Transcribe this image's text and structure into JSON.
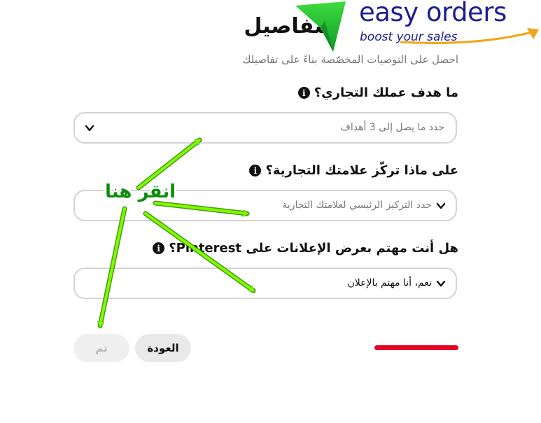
{
  "header": {
    "title": "التفاصيل",
    "subtitle": "احصل على التوصيات المخصّصة بناءً على تفاصيلك"
  },
  "logo": {
    "brand": "easy orders",
    "tagline": "boost your sales",
    "colors": {
      "text": "#1d1f8e",
      "triangle_top": "#3ddc3d",
      "triangle_bottom": "#0f9a2b",
      "swoosh": "#f2a516"
    }
  },
  "form": {
    "q1": {
      "label": "ما هدف عملك التجاري؟",
      "placeholder": "حدد ما يصل إلى 3 أهداف"
    },
    "q2": {
      "label": "على ماذا تركّز علامتك التجارية؟",
      "placeholder": "حدد التركيز الرئيسي لعلامتك التجارية"
    },
    "q3": {
      "label": "هل أنت مهتم بعرض الإعلانات على Pinterest؟",
      "value": "نعم، أنا مهتم بالإعلان"
    }
  },
  "icons": {
    "info": "info-icon",
    "chevron": "chevron-down-icon"
  },
  "buttons": {
    "done": "تم",
    "back": "العودة"
  },
  "progress": {
    "value": 1.0,
    "color": "#e60023"
  },
  "annotation": {
    "label": "انقر هنا",
    "color": "#7cfc00"
  }
}
